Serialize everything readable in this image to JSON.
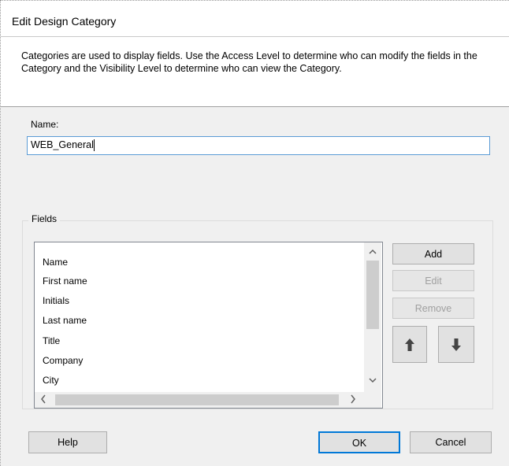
{
  "dialog": {
    "title": "Edit Design Category",
    "description": "Categories are used to display fields.  Use the Access Level to determine who can modify the fields in the Category and the Visibility Level to determine who can view the Category."
  },
  "name": {
    "label": "Name:",
    "value": "WEB_General"
  },
  "fields": {
    "group_label": "Fields",
    "column_header": "Name",
    "items": [
      "First name",
      "Initials",
      "Last name",
      "Title",
      "Company",
      "City"
    ],
    "buttons": {
      "add": "Add",
      "edit": "Edit",
      "remove": "Remove"
    },
    "move_up_icon": "arrow-up-icon",
    "move_down_icon": "arrow-down-icon"
  },
  "footer": {
    "help": "Help",
    "ok": "OK",
    "cancel": "Cancel"
  },
  "colors": {
    "focus_border": "#0078d7",
    "input_border": "#5b9bd5",
    "dialog_bg": "#f0f0f0"
  }
}
